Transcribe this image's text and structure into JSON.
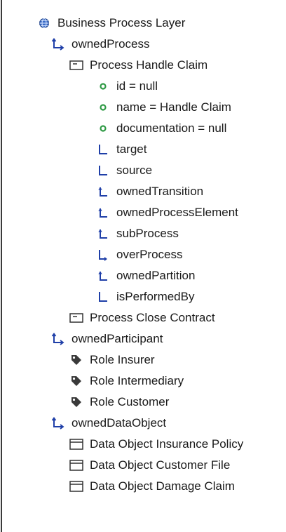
{
  "tree": {
    "root": {
      "label": "Business Process Layer",
      "icon": "globe-icon"
    },
    "owned_process": {
      "label": "ownedProcess",
      "icon": "containment-reference-icon",
      "process_handle_claim": {
        "label": "Process Handle Claim",
        "icon": "process-icon",
        "attributes": [
          {
            "label": "id = null",
            "icon": "attribute-dot-icon"
          },
          {
            "label": "name = Handle Claim",
            "icon": "attribute-dot-icon"
          },
          {
            "label": "documentation = null",
            "icon": "attribute-dot-icon"
          }
        ],
        "references": [
          {
            "label": "target",
            "icon": "reference-icon"
          },
          {
            "label": "source",
            "icon": "reference-icon"
          },
          {
            "label": "ownedTransition",
            "icon": "containment-up-icon"
          },
          {
            "label": "ownedProcessElement",
            "icon": "containment-up-icon"
          },
          {
            "label": "subProcess",
            "icon": "containment-up-icon"
          },
          {
            "label": "overProcess",
            "icon": "container-reference-icon"
          },
          {
            "label": "ownedPartition",
            "icon": "containment-up-icon"
          },
          {
            "label": "isPerformedBy",
            "icon": "reference-icon"
          }
        ]
      },
      "process_close_contract": {
        "label": "Process Close Contract",
        "icon": "process-icon"
      }
    },
    "owned_participant": {
      "label": "ownedParticipant",
      "icon": "containment-reference-icon",
      "roles": [
        {
          "label": "Role Insurer",
          "icon": "tag-icon"
        },
        {
          "label": "Role Intermediary",
          "icon": "tag-icon"
        },
        {
          "label": "Role Customer",
          "icon": "tag-icon"
        }
      ]
    },
    "owned_data_object": {
      "label": "ownedDataObject",
      "icon": "containment-reference-icon",
      "data_objects": [
        {
          "label": "Data Object Insurance Policy",
          "icon": "data-object-icon"
        },
        {
          "label": "Data Object Customer File",
          "icon": "data-object-icon"
        },
        {
          "label": "Data Object Damage Claim",
          "icon": "data-object-icon"
        }
      ]
    }
  },
  "colors": {
    "reference_blue": "#1f3fa8",
    "attribute_green": "#2f9a45",
    "text": "#1a1a1a"
  }
}
